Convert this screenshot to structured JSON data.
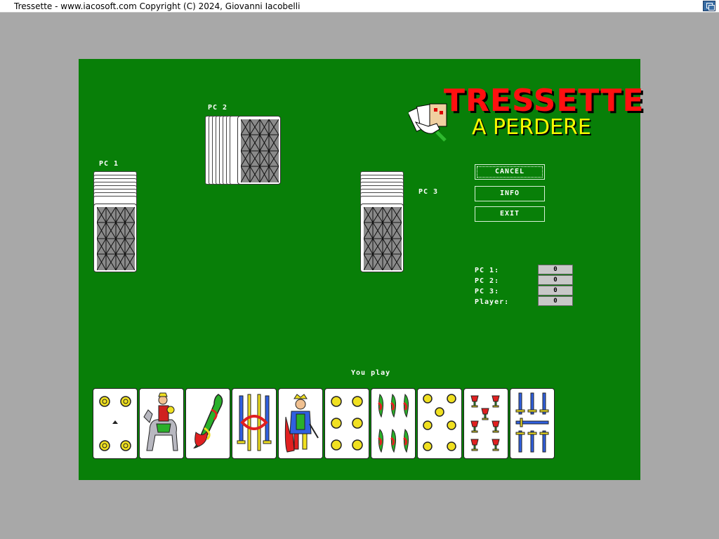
{
  "window": {
    "title": "Tressette - www.iacosoft.com Copyright (C) 2024, Giovanni Iacobelli"
  },
  "logo": {
    "title": "TRESSETTE",
    "subtitle": "A PERDERE"
  },
  "players": {
    "pc1": "PC 1",
    "pc2": "PC 2",
    "pc3": "PC 3"
  },
  "buttons": {
    "cancel": "CANCEL",
    "info": "INFO",
    "exit": "EXIT"
  },
  "scores": [
    {
      "label": "PC 1:",
      "value": "0"
    },
    {
      "label": "PC 2:",
      "value": "0"
    },
    {
      "label": "PC 3:",
      "value": "0"
    },
    {
      "label": "Player:",
      "value": "0"
    }
  ],
  "status": "You play",
  "colors": {
    "table": "#087f08",
    "background": "#a8a8a8",
    "logo_red": "#ff1010",
    "logo_yellow": "#f8f800"
  },
  "hand": [
    {
      "name": "card-4-coins",
      "suit": "coins",
      "rank": "4"
    },
    {
      "name": "card-knight",
      "suit": "coins",
      "rank": "knight"
    },
    {
      "name": "card-ace-batons",
      "suit": "batons",
      "rank": "ace"
    },
    {
      "name": "card-4-swords",
      "suit": "swords",
      "rank": "4"
    },
    {
      "name": "card-king",
      "suit": "coins",
      "rank": "king"
    },
    {
      "name": "card-6-coins",
      "suit": "coins",
      "rank": "6"
    },
    {
      "name": "card-6-batons",
      "suit": "batons",
      "rank": "6"
    },
    {
      "name": "card-7-coins",
      "suit": "coins",
      "rank": "7"
    },
    {
      "name": "card-7-cups",
      "suit": "cups",
      "rank": "7"
    },
    {
      "name": "card-7-swords",
      "suit": "swords",
      "rank": "7"
    }
  ]
}
